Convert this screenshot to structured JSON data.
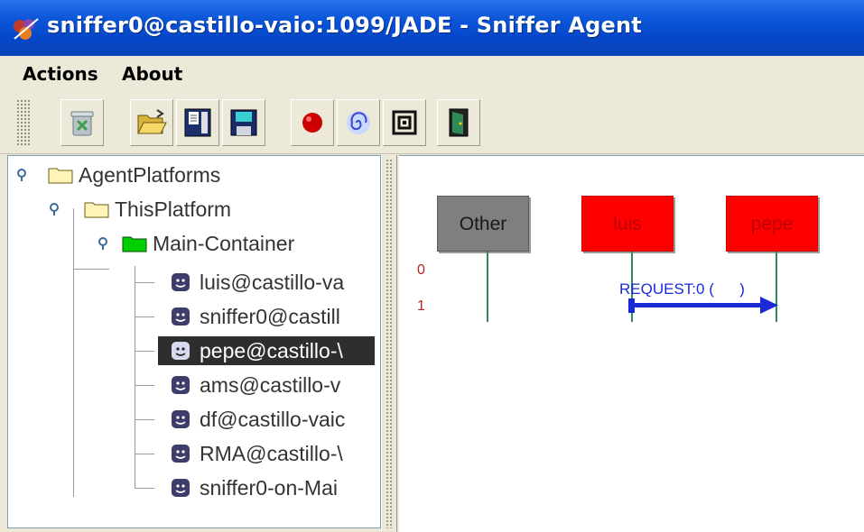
{
  "window": {
    "title": "sniffer0@castillo-vaio:1099/JADE - Sniffer Agent",
    "title_icon": "jade-logo-icon"
  },
  "menu": {
    "items": [
      {
        "label": "Actions"
      },
      {
        "label": "About"
      }
    ]
  },
  "toolbar": {
    "buttons": [
      {
        "icon": "clear-canvas-icon"
      },
      {
        "icon": "open-folder-icon"
      },
      {
        "icon": "display-log-icon"
      },
      {
        "icon": "save-icon"
      },
      {
        "icon": "record-icon"
      },
      {
        "icon": "sniff-agent-icon"
      },
      {
        "icon": "no-sniff-icon"
      },
      {
        "icon": "exit-door-icon"
      }
    ]
  },
  "tree": {
    "root": {
      "label": "AgentPlatforms"
    },
    "platform": {
      "label": "ThisPlatform"
    },
    "container": {
      "label": "Main-Container"
    },
    "agents": [
      {
        "label": "luis@castillo-va",
        "selected": false
      },
      {
        "label": "sniffer0@castill",
        "selected": false
      },
      {
        "label": "pepe@castillo-\\",
        "selected": true
      },
      {
        "label": "ams@castillo-v",
        "selected": false
      },
      {
        "label": "df@castillo-vaic",
        "selected": false
      },
      {
        "label": "RMA@castillo-\\",
        "selected": false
      },
      {
        "label": "sniffer0-on-Mai",
        "selected": false
      }
    ]
  },
  "canvas": {
    "agents": [
      {
        "label": "Other",
        "color": "#7f7f7f"
      },
      {
        "label": "luis",
        "color": "#ff0000"
      },
      {
        "label": "pepe",
        "color": "#ff0000"
      }
    ],
    "row_numbers": [
      "0",
      "1"
    ],
    "message": {
      "label": "REQUEST:0 (      )",
      "from": "luis",
      "to": "pepe",
      "color": "#1a2bd6"
    }
  },
  "colors": {
    "title_bar": "#0a55d8",
    "selection": "#2e2e2e",
    "lifeline": "#2e8b57"
  }
}
